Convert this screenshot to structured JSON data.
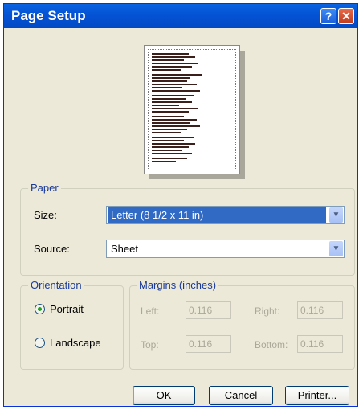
{
  "window": {
    "title": "Page Setup",
    "help_glyph": "?",
    "close_glyph": "✕"
  },
  "paper": {
    "group_label": "Paper",
    "size_label": "Size:",
    "size_value": "Letter (8 1/2 x 11 in)",
    "source_label": "Source:",
    "source_value": "Sheet"
  },
  "orientation": {
    "group_label": "Orientation",
    "portrait": "Portrait",
    "landscape": "Landscape",
    "selected": "portrait"
  },
  "margins": {
    "group_label": "Margins (inches)",
    "left_label": "Left:",
    "left_value": "0.116",
    "right_label": "Right:",
    "right_value": "0.116",
    "top_label": "Top:",
    "top_value": "0.116",
    "bottom_label": "Bottom:",
    "bottom_value": "0.116"
  },
  "buttons": {
    "ok": "OK",
    "cancel": "Cancel",
    "printer": "Printer..."
  },
  "colors": {
    "title_bar": "#0453d5",
    "selection": "#316ac5",
    "dialog_bg": "#ece9d8"
  }
}
